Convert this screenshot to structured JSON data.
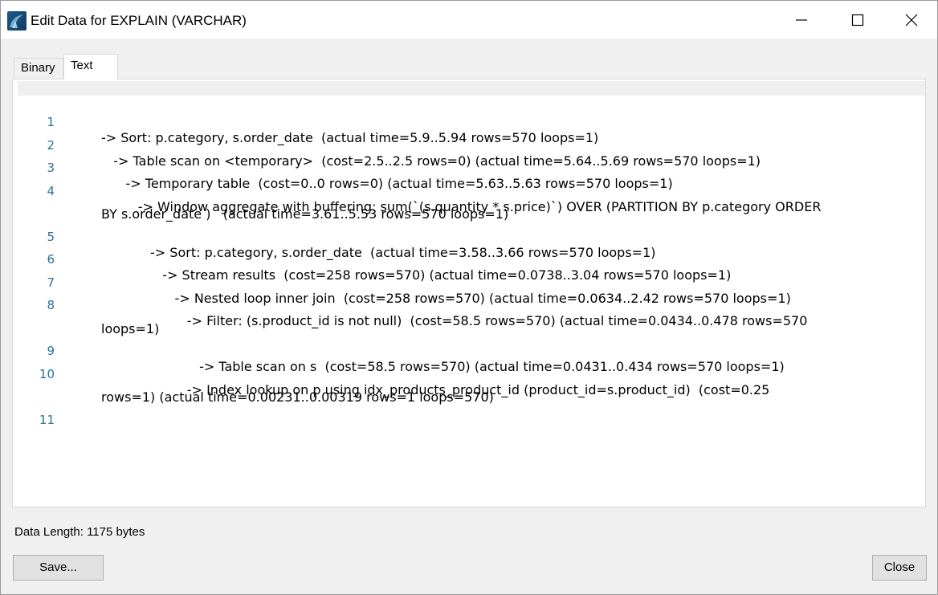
{
  "window": {
    "title": "Edit Data for EXPLAIN (VARCHAR)",
    "app_icon": "mysql-workbench-icon"
  },
  "tabs": [
    {
      "label": "Binary",
      "active": false
    },
    {
      "label": "Text",
      "active": true
    }
  ],
  "editor": {
    "lines": [
      {
        "num": "1",
        "text": "-> Sort: p.category, s.order_date  (actual time=5.9..5.94 rows=570 loops=1)",
        "wrap": ""
      },
      {
        "num": "2",
        "text": "   -> Table scan on <temporary>  (cost=2.5..2.5 rows=0) (actual time=5.64..5.69 rows=570 loops=1)",
        "wrap": ""
      },
      {
        "num": "3",
        "text": "      -> Temporary table  (cost=0..0 rows=0) (actual time=5.63..5.63 rows=570 loops=1)",
        "wrap": ""
      },
      {
        "num": "4",
        "text": "         -> Window aggregate with buffering: sum(`(s.quantity * s.price)`) OVER (PARTITION BY p.category ORDER",
        "wrap": "BY s.order_date )   (actual time=3.61..5.53 rows=570 loops=1)"
      },
      {
        "num": "5",
        "text": "            -> Sort: p.category, s.order_date  (actual time=3.58..3.66 rows=570 loops=1)",
        "wrap": ""
      },
      {
        "num": "6",
        "text": "               -> Stream results  (cost=258 rows=570) (actual time=0.0738..3.04 rows=570 loops=1)",
        "wrap": ""
      },
      {
        "num": "7",
        "text": "                  -> Nested loop inner join  (cost=258 rows=570) (actual time=0.0634..2.42 rows=570 loops=1)",
        "wrap": ""
      },
      {
        "num": "8",
        "text": "                     -> Filter: (s.product_id is not null)  (cost=58.5 rows=570) (actual time=0.0434..0.478 rows=570",
        "wrap": "loops=1)"
      },
      {
        "num": "9",
        "text": "                        -> Table scan on s  (cost=58.5 rows=570) (actual time=0.0431..0.434 rows=570 loops=1)",
        "wrap": ""
      },
      {
        "num": "10",
        "text": "                     -> Index lookup on p using idx_products_product_id (product_id=s.product_id)  (cost=0.25",
        "wrap": "rows=1) (actual time=0.00231..0.00319 rows=1 loops=570)"
      },
      {
        "num": "11",
        "text": "",
        "wrap": ""
      }
    ]
  },
  "footer": {
    "data_length": "Data Length: 1175 bytes",
    "save_label": "Save...",
    "close_label": "Close"
  }
}
